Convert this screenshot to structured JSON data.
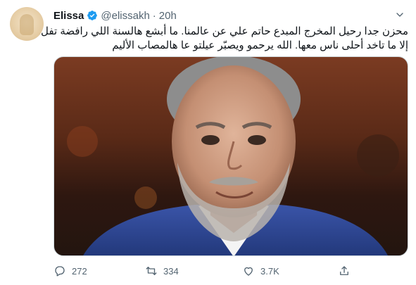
{
  "author": {
    "name": "Elissa",
    "handle": "@elissakh",
    "separator": "·",
    "time": "20h"
  },
  "tweet": {
    "lines": [
      "محزن جدا رحيل المخرج المبدع حاتم علي عن عالمنا. ما أبشع هالسنة اللي رافضة تفل",
      "إلا ما تاخد أحلى ناس معها. الله يرحمو ويصبّر عيلتو عا هالمصاب الأليم"
    ]
  },
  "media": {
    "description_icon": "photo-portrait"
  },
  "actions": {
    "replies": "272",
    "retweets": "334",
    "likes": "3.7K"
  },
  "colors": {
    "verified": "#1d9bf0",
    "muted": "#536471",
    "text": "#0f1419"
  }
}
